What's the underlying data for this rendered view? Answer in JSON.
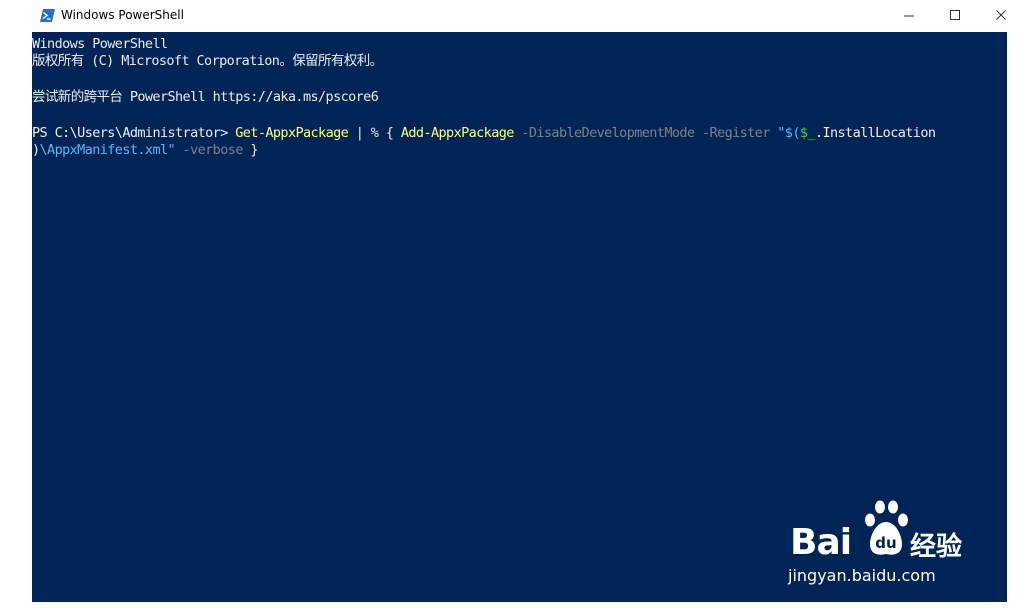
{
  "window": {
    "title": "Windows PowerShell",
    "icon": "powershell-icon",
    "controls": {
      "minimize": "–",
      "maximize": "☐",
      "close": "✕"
    }
  },
  "console": {
    "banner_line1": "Windows PowerShell",
    "banner_line2": "版权所有 (C) Microsoft Corporation。保留所有权利。",
    "banner_line3": "尝试新的跨平台 PowerShell https://aka.ms/pscore6",
    "prompt": "PS C:\\Users\\Administrator> ",
    "cmd1": "Get-AppxPackage",
    "pipe": " | % { ",
    "cmd2": "Add-AppxPackage",
    "param1": " -DisableDevelopmentMode -Register ",
    "str_open": "\"$(",
    "var": "$_",
    "prop": ".InstallLocation",
    "cont_paren": ")",
    "str_rest": "\\AppxManifest.xml\"",
    "param2": " -verbose ",
    "close_brace": "}"
  },
  "watermark": {
    "brand": "Bai",
    "brand_cn": "经验",
    "url": "jingyan.baidu.com"
  },
  "colors": {
    "console_bg": "#012456",
    "text": "#ececec",
    "command": "#ffff80",
    "parameter": "#808080",
    "string": "#5fb4ff",
    "variable": "#41d541"
  }
}
